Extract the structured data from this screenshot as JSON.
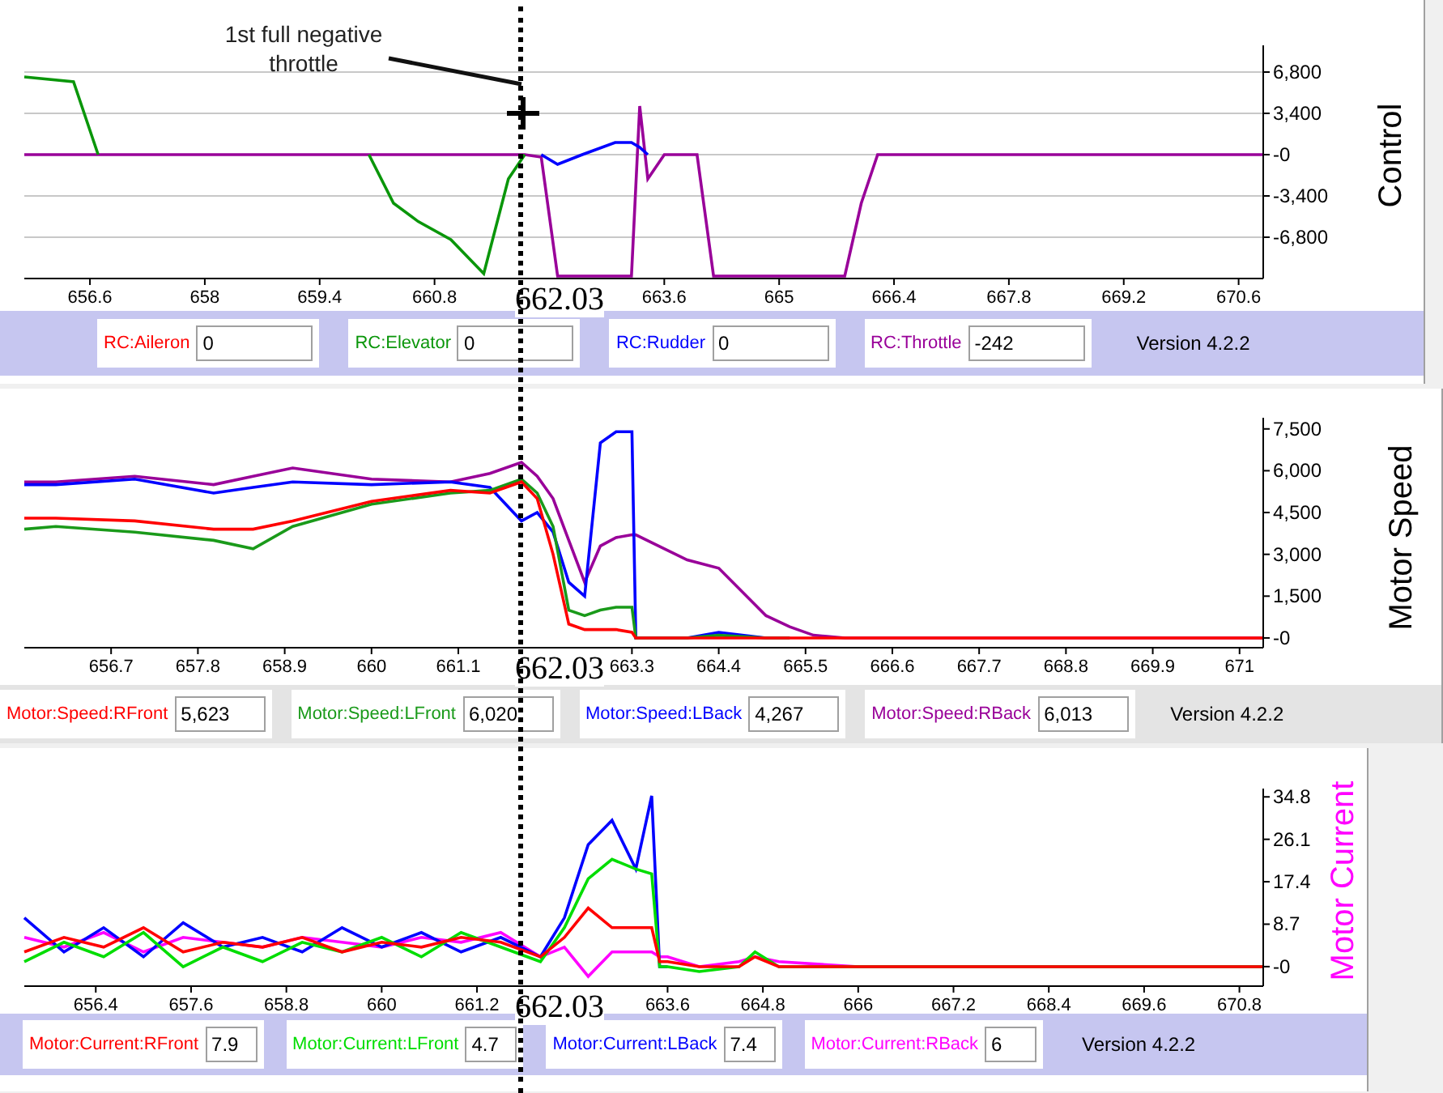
{
  "annotation": {
    "text": "1st full negative throttle"
  },
  "panels": [
    {
      "cursor_label": "662.03",
      "chart_data": {
        "type": "line",
        "ylabel": "Control",
        "grid": true,
        "xlim": [
          655.8,
          670.9
        ],
        "ylim": [
          -10200,
          9000
        ],
        "xticks": [
          656.6,
          658,
          659.4,
          660.8,
          663.6,
          665,
          666.4,
          667.8,
          669.2,
          670.6
        ],
        "yticks": [
          {
            "value": 6800,
            "label": "6,800"
          },
          {
            "value": 3400,
            "label": "3,400"
          },
          {
            "value": 0,
            "label": "-0"
          },
          {
            "value": -3400,
            "label": "-3,400"
          },
          {
            "value": -6800,
            "label": "-6,800"
          }
        ],
        "x": [
          655.8,
          656.4,
          656.7,
          657.5,
          659,
          660,
          660.3,
          660.6,
          661,
          661.4,
          661.7,
          661.9,
          662.1,
          662.3,
          662.6,
          663,
          663.2,
          663.3,
          663.4,
          663.6,
          663.8,
          664,
          664.2,
          665,
          665.8,
          666,
          666.2,
          667,
          670.9
        ],
        "series": [
          {
            "name": "RC:Aileron",
            "color": "#ff0000",
            "values": [
              null,
              null,
              null,
              null,
              null,
              null,
              null,
              null,
              null,
              null,
              null,
              null,
              null,
              null,
              null,
              null,
              null,
              null,
              null,
              null,
              null,
              null,
              null,
              null,
              null,
              null,
              null,
              null,
              null
            ]
          },
          {
            "name": "RC:Elevator",
            "color": "#0a960a",
            "values": [
              6400,
              6000,
              0,
              null,
              null,
              0,
              -4000,
              -5500,
              -7000,
              -9800,
              -2000,
              0,
              null,
              null,
              null,
              null,
              null,
              null,
              null,
              null,
              null,
              null,
              null,
              null,
              null,
              null,
              null,
              null,
              null
            ]
          },
          {
            "name": "RC:Rudder",
            "color": "#0000ff",
            "values": [
              null,
              null,
              null,
              null,
              null,
              null,
              null,
              null,
              null,
              null,
              null,
              null,
              0,
              -800,
              0,
              1000,
              1000,
              600,
              0,
              null,
              null,
              null,
              null,
              null,
              null,
              null,
              null,
              null,
              null
            ]
          },
          {
            "name": "RC:Throttle",
            "color": "#990099",
            "values": [
              0,
              0,
              0,
              0,
              0,
              0,
              0,
              0,
              0,
              0,
              0,
              0,
              -200,
              -10000,
              -10000,
              -10000,
              -10000,
              4000,
              -2000,
              0,
              0,
              0,
              -10000,
              -10000,
              -10000,
              -4000,
              0,
              0,
              0
            ]
          }
        ]
      },
      "readouts": [
        {
          "value": "0"
        },
        {
          "value": "0"
        },
        {
          "value": "0"
        },
        {
          "value": "-242"
        }
      ],
      "version": "Version 4.2.2"
    },
    {
      "cursor_label": "662.03",
      "chart_data": {
        "type": "line",
        "ylabel": "Motor Speed",
        "xlim": [
          655.6,
          671.3
        ],
        "ylim": [
          -350,
          7900
        ],
        "xticks": [
          656.7,
          657.8,
          658.9,
          660,
          661.1,
          663.3,
          664.4,
          665.5,
          666.6,
          667.7,
          668.8,
          669.9,
          671
        ],
        "yticks": [
          {
            "value": 7500,
            "label": "7,500"
          },
          {
            "value": 6000,
            "label": "6,000"
          },
          {
            "value": 4500,
            "label": "4,500"
          },
          {
            "value": 3000,
            "label": "3,000"
          },
          {
            "value": 1500,
            "label": "1,500"
          },
          {
            "value": 0,
            "label": "-0"
          }
        ],
        "x": [
          655.6,
          656,
          657,
          658,
          658.5,
          659,
          660,
          661,
          661.5,
          661.9,
          662.1,
          662.3,
          662.5,
          662.7,
          662.9,
          663.1,
          663.3,
          663.35,
          664,
          664.4,
          665,
          665.3,
          665.6,
          666,
          671.3
        ],
        "series": [
          {
            "name": "Motor:Speed:RFront",
            "color": "#ff0000",
            "values": [
              4300,
              4300,
              4200,
              3900,
              3900,
              4200,
              4900,
              5300,
              5200,
              5600,
              5000,
              3000,
              500,
              300,
              300,
              300,
              200,
              0,
              0,
              0,
              0,
              0,
              0,
              0,
              0
            ]
          },
          {
            "name": "Motor:Speed:LFront",
            "color": "#1a9a1a",
            "values": [
              3900,
              4000,
              3800,
              3500,
              3200,
              4000,
              4800,
              5200,
              5300,
              5700,
              5200,
              4000,
              1000,
              800,
              1000,
              1100,
              1100,
              0,
              0,
              100,
              0,
              0,
              null,
              null,
              null
            ]
          },
          {
            "name": "Motor:Speed:LBack",
            "color": "#0000ff",
            "values": [
              5500,
              5500,
              5700,
              5200,
              5400,
              5600,
              5500,
              5600,
              5400,
              4200,
              4500,
              3800,
              2000,
              1500,
              7000,
              7400,
              7400,
              0,
              0,
              200,
              0,
              0,
              null,
              null,
              null
            ]
          },
          {
            "name": "Motor:Speed:RBack",
            "color": "#990099",
            "values": [
              5600,
              5600,
              5800,
              5500,
              5800,
              6100,
              5700,
              5600,
              5900,
              6300,
              5800,
              5000,
              3500,
              2000,
              3300,
              3600,
              3700,
              3700,
              2800,
              2500,
              800,
              400,
              100,
              0,
              0
            ]
          }
        ]
      },
      "readouts": [
        {
          "value": "5,623"
        },
        {
          "value": "6,020"
        },
        {
          "value": "4,267"
        },
        {
          "value": "6,013"
        }
      ],
      "version": "Version 4.2.2"
    },
    {
      "cursor_label": "662.03",
      "chart_data": {
        "type": "line",
        "ylabel": "Motor Current",
        "xlim": [
          655.5,
          671.1
        ],
        "ylim": [
          -4,
          36.5
        ],
        "xticks": [
          656.4,
          657.6,
          658.8,
          660,
          661.2,
          663.6,
          664.8,
          666,
          667.2,
          668.4,
          669.6,
          670.8
        ],
        "yticks": [
          {
            "value": 34.8,
            "label": "34.8"
          },
          {
            "value": 26.1,
            "label": "26.1"
          },
          {
            "value": 17.4,
            "label": "17.4"
          },
          {
            "value": 8.7,
            "label": "8.7"
          },
          {
            "value": 0,
            "label": "-0"
          }
        ],
        "x": [
          655.5,
          656,
          656.5,
          657,
          657.5,
          658,
          658.5,
          659,
          659.5,
          660,
          660.5,
          661,
          661.5,
          662,
          662.3,
          662.6,
          662.9,
          663.2,
          663.4,
          663.5,
          663.6,
          664,
          664.5,
          664.7,
          665,
          666,
          671.1
        ],
        "series": [
          {
            "name": "Motor:Current:RFront",
            "color": "#ff0000",
            "values": [
              3,
              6,
              4,
              8,
              3,
              5,
              4,
              6,
              3,
              5,
              4,
              6,
              5,
              2,
              6,
              12,
              8,
              8,
              8,
              1,
              1,
              0,
              0,
              2,
              0,
              0,
              0
            ]
          },
          {
            "name": "Motor:Current:LFront",
            "color": "#00dd00",
            "values": [
              1,
              5,
              2,
              7,
              0,
              4,
              1,
              5,
              3,
              6,
              2,
              7,
              4,
              1,
              8,
              18,
              22,
              20,
              19,
              0,
              0,
              -1,
              0,
              3,
              0,
              0,
              0
            ]
          },
          {
            "name": "Motor:Current:LBack",
            "color": "#0000ff",
            "values": [
              10,
              3,
              8,
              2,
              9,
              4,
              6,
              3,
              8,
              4,
              7,
              3,
              6,
              2,
              10,
              25,
              30,
              20,
              35,
              0,
              0,
              null,
              null,
              null,
              null,
              null,
              null
            ]
          },
          {
            "name": "Motor:Current:RBack",
            "color": "#ff00ff",
            "values": [
              6,
              4,
              7,
              3,
              6,
              5,
              4,
              6,
              5,
              4,
              6,
              5,
              7,
              2,
              4,
              -2,
              3,
              3,
              3,
              2,
              2,
              0,
              1,
              2,
              1,
              0,
              0
            ]
          }
        ]
      },
      "readouts": [
        {
          "value": "7.9"
        },
        {
          "value": "4.7"
        },
        {
          "value": "7.4"
        },
        {
          "value": "6"
        }
      ],
      "version": "Version 4.2.2"
    }
  ]
}
